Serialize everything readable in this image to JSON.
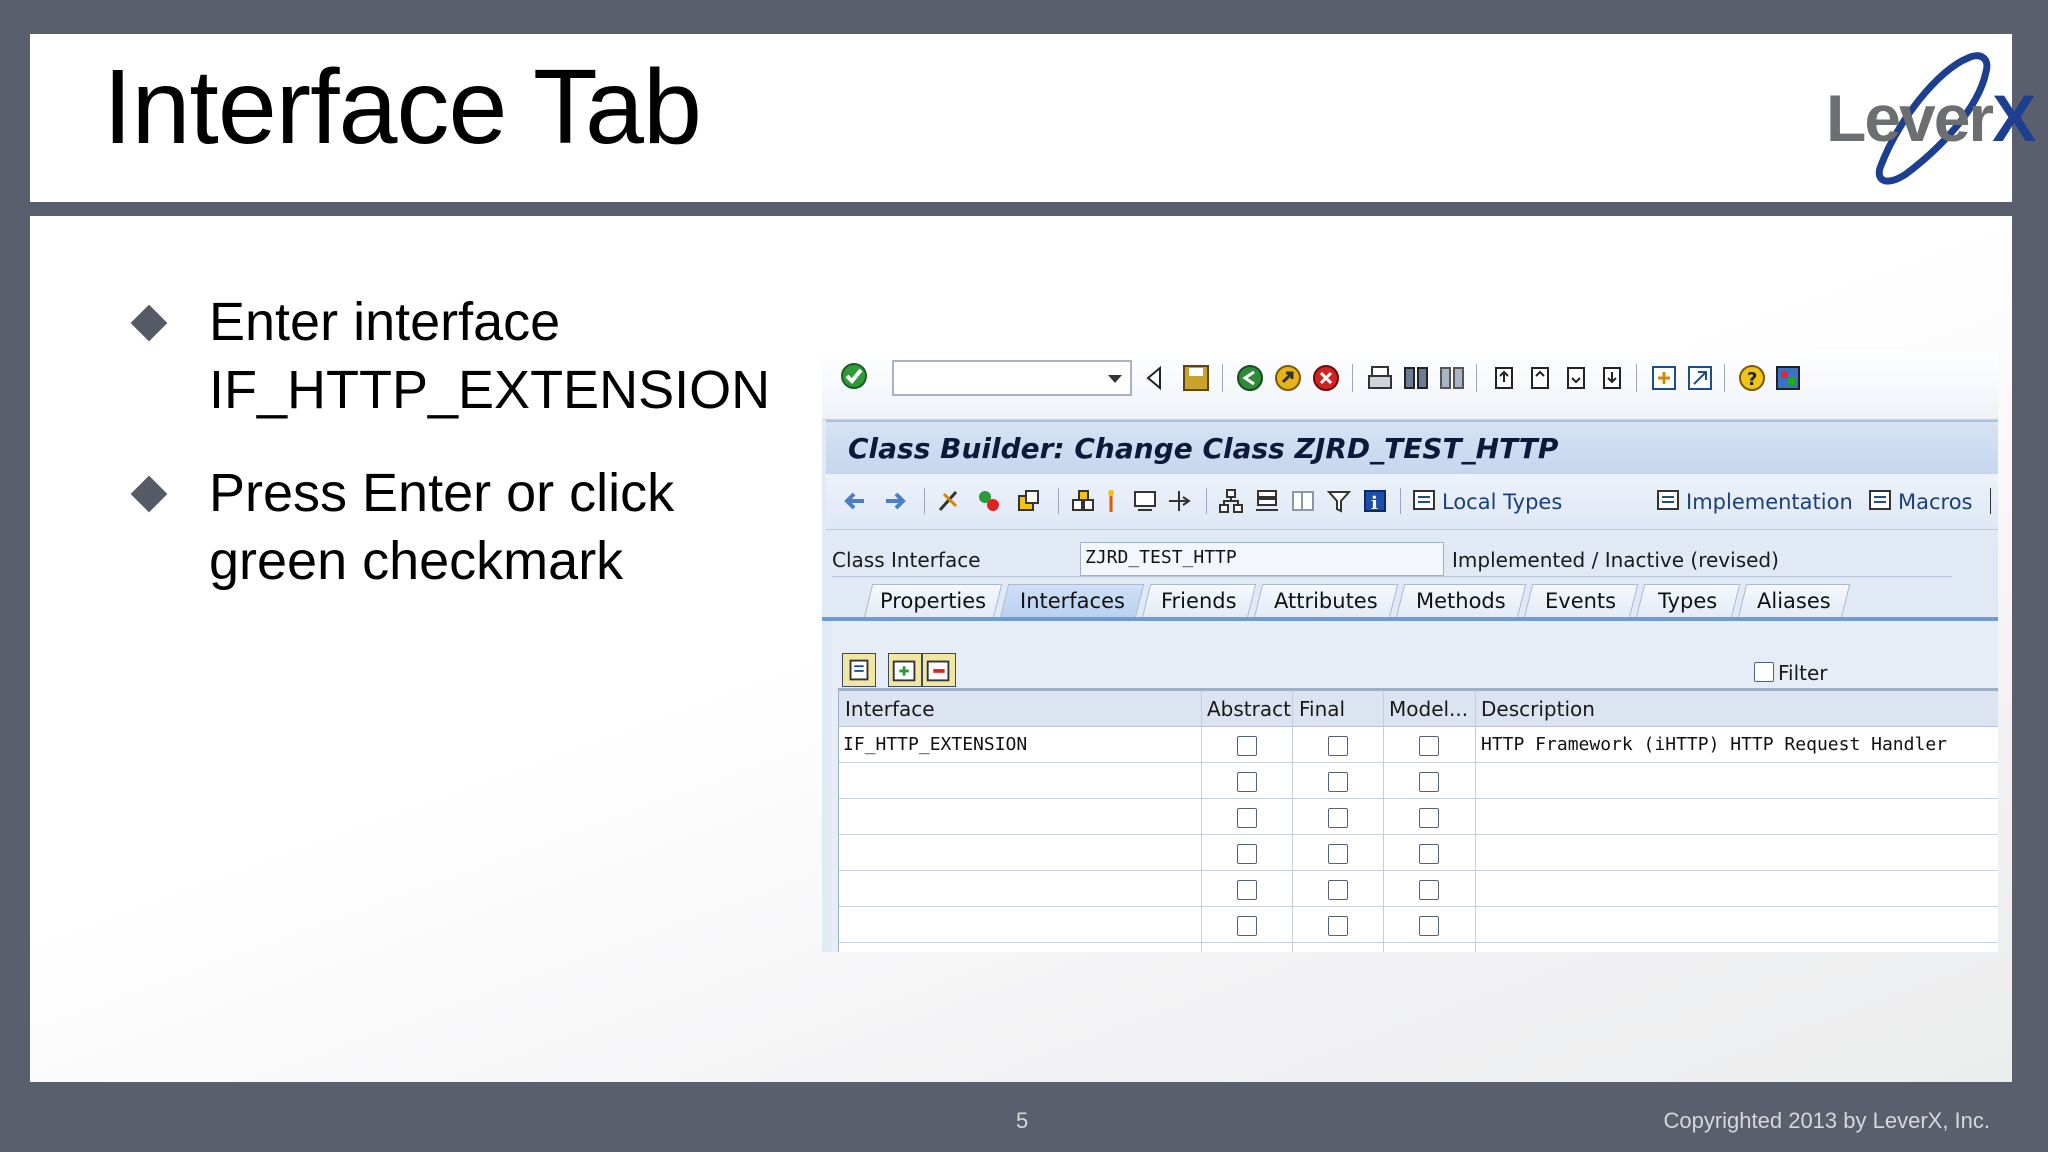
{
  "slide": {
    "title": "Interface Tab",
    "logo_text_main": "Lever",
    "logo_text_x": "X",
    "bullets": [
      {
        "line1": "Enter interface",
        "line2": "IF_HTTP_EXTENSION"
      },
      {
        "line1": "Press Enter or click",
        "line2": "green checkmark"
      }
    ],
    "page_number": "5",
    "copyright": "Copyrighted 2013 by LeverX, Inc."
  },
  "sap": {
    "command_field_value": "",
    "window_title": "Class Builder: Change Class ZJRD_TEST_HTTP",
    "app_toolbar": {
      "local_types": "Local Types",
      "implementation": "Implementation",
      "macros": "Macros"
    },
    "class_interface_label": "Class Interface",
    "class_interface_value": "ZJRD_TEST_HTTP",
    "status_text": "Implemented / Inactive (revised)",
    "tabs": [
      "Properties",
      "Interfaces",
      "Friends",
      "Attributes",
      "Methods",
      "Events",
      "Types",
      "Aliases"
    ],
    "active_tab": "Interfaces",
    "filter_label": "Filter",
    "table": {
      "columns": [
        "Interface",
        "Abstract",
        "Final",
        "Model...",
        "Description"
      ],
      "rows": [
        {
          "interface": "IF_HTTP_EXTENSION",
          "description": "HTTP Framework (iHTTP) HTTP Request Handler"
        },
        {
          "interface": "",
          "description": ""
        },
        {
          "interface": "",
          "description": ""
        },
        {
          "interface": "",
          "description": ""
        },
        {
          "interface": "",
          "description": ""
        },
        {
          "interface": "",
          "description": ""
        }
      ]
    }
  }
}
